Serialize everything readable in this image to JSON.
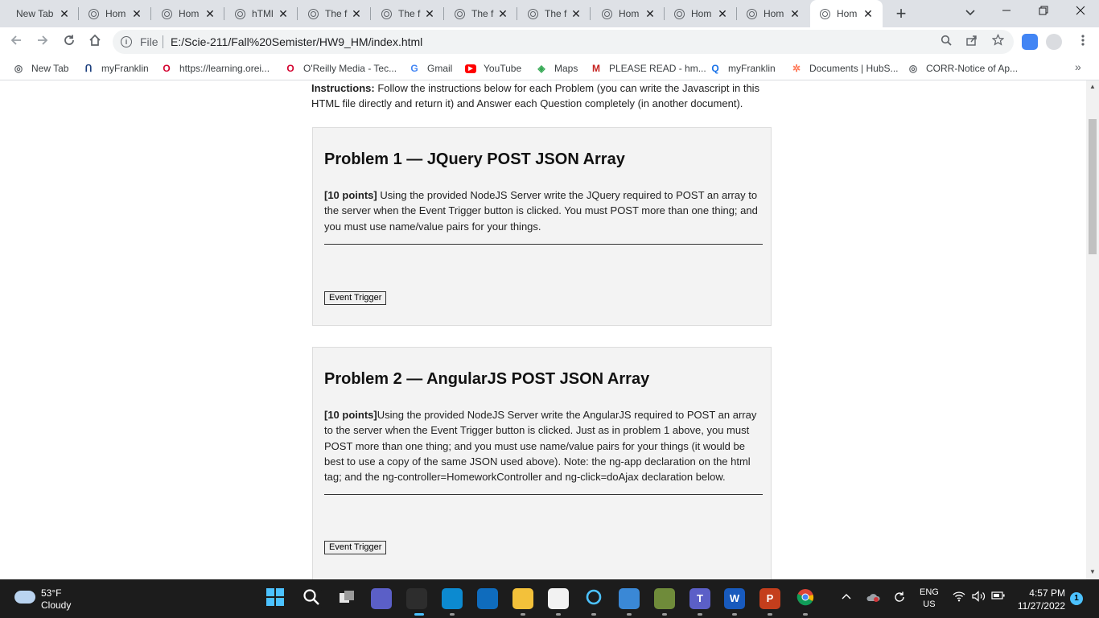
{
  "browser": {
    "tabs": [
      {
        "label": "New Tab",
        "icon": "none",
        "active": false
      },
      {
        "label": "Hom",
        "icon": "globe",
        "active": false
      },
      {
        "label": "Hom",
        "icon": "globe",
        "active": false
      },
      {
        "label": "hTMl",
        "icon": "globe",
        "active": false
      },
      {
        "label": "The f",
        "icon": "globe",
        "active": false
      },
      {
        "label": "The f",
        "icon": "globe",
        "active": false
      },
      {
        "label": "The f",
        "icon": "globe",
        "active": false
      },
      {
        "label": "The f",
        "icon": "globe",
        "active": false
      },
      {
        "label": "Hom",
        "icon": "globe",
        "active": false
      },
      {
        "label": "Hom",
        "icon": "globe",
        "active": false
      },
      {
        "label": "Hom",
        "icon": "globe",
        "active": false
      },
      {
        "label": "Hom",
        "icon": "globe",
        "active": true
      }
    ],
    "close_glyph": "✕",
    "new_tab_glyph": "+",
    "address": {
      "scheme": "File",
      "url": "E:/Scie-211/Fall%20Semister/HW9_HM/index.html"
    },
    "bookmarks": [
      {
        "label": "New Tab",
        "icon": "globe-icon",
        "color": "#5f6368"
      },
      {
        "label": "myFranklin",
        "icon": "franklin-icon",
        "color": "#1a3d7c"
      },
      {
        "label": "https://learning.orei...",
        "icon": "oreilly-icon",
        "color": "#d3002d"
      },
      {
        "label": "O'Reilly Media - Tec...",
        "icon": "oreilly-icon",
        "color": "#d3002d"
      },
      {
        "label": "Gmail",
        "icon": "google-icon",
        "color": "#4285f4"
      },
      {
        "label": "YouTube",
        "icon": "youtube-icon",
        "color": "#ff0000"
      },
      {
        "label": "Maps",
        "icon": "maps-icon",
        "color": "#34a853"
      },
      {
        "label": "PLEASE READ - hm...",
        "icon": "gmail-icon",
        "color": "#c5221f"
      },
      {
        "label": "myFranklin",
        "icon": "search-icon",
        "color": "#1a73e8"
      },
      {
        "label": "Documents | HubS...",
        "icon": "hubspot-icon",
        "color": "#ff7a59"
      },
      {
        "label": "CORR-Notice of Ap...",
        "icon": "globe-icon",
        "color": "#5f6368"
      }
    ]
  },
  "page": {
    "instructions_label": "Instructions:",
    "instructions_text": " Follow the instructions below for each Problem (you can write the Javascript in this HTML file directly and return it) and Answer each Question completely (in another document).",
    "problems": [
      {
        "title": "Problem 1 — JQuery POST JSON Array",
        "points": "[10 points]",
        "description": " Using the provided NodeJS Server write the JQuery required to POST an array to the server when the Event Trigger button is clicked. You must POST more than one thing; and you must use name/value pairs for your things.",
        "button": "Event Trigger"
      },
      {
        "title": "Problem 2 — AngularJS POST JSON Array",
        "points": "[10 points]",
        "description": "Using the provided NodeJS Server write the AngularJS required to POST an array to the server when the Event Trigger button is clicked. Just as in problem 1 above, you must POST more than one thing; and you must use name/value pairs for your things (it would be best to use a copy of the same JSON used above). Note: the ng-app declaration on the html tag; and the ng-controller=HomeworkController and ng-click=doAjax declaration below.",
        "button": "Event Trigger"
      }
    ]
  },
  "taskbar": {
    "weather_temp": "53°F",
    "weather_desc": "Cloudy",
    "lang_line1": "ENG",
    "lang_line2": "US",
    "time": "4:57 PM",
    "date": "11/27/2022",
    "notification_count": "1",
    "apps": [
      {
        "name": "start-icon",
        "glyph": "",
        "color": "#1c1c1c"
      },
      {
        "name": "search-icon",
        "glyph": "",
        "color": "#1c1c1c"
      },
      {
        "name": "task-view-icon",
        "glyph": "",
        "color": "#1c1c1c"
      },
      {
        "name": "chat-icon",
        "glyph": "",
        "color": "#5b5fc7"
      },
      {
        "name": "edge-dev-icon",
        "glyph": "",
        "color": "#2d2d2d"
      },
      {
        "name": "edge-icon",
        "glyph": "",
        "color": "#0c8ad0"
      },
      {
        "name": "mail-icon",
        "glyph": "",
        "color": "#0f6cbd"
      },
      {
        "name": "file-explorer-icon",
        "glyph": "",
        "color": "#f3c13a"
      },
      {
        "name": "store-icon",
        "glyph": "",
        "color": "#f2f2f2"
      },
      {
        "name": "cortana-icon",
        "glyph": "",
        "color": "#1c1c1c"
      },
      {
        "name": "messaging-icon",
        "glyph": "",
        "color": "#3a88d6"
      },
      {
        "name": "notepad-icon",
        "glyph": "",
        "color": "#6f8b3a"
      },
      {
        "name": "teams-icon",
        "glyph": "T",
        "color": "#5b5fc7"
      },
      {
        "name": "word-icon",
        "glyph": "W",
        "color": "#185abd"
      },
      {
        "name": "powerpoint-icon",
        "glyph": "P",
        "color": "#c43e1c"
      },
      {
        "name": "chrome-icon",
        "glyph": "",
        "color": "#1c1c1c"
      }
    ]
  }
}
